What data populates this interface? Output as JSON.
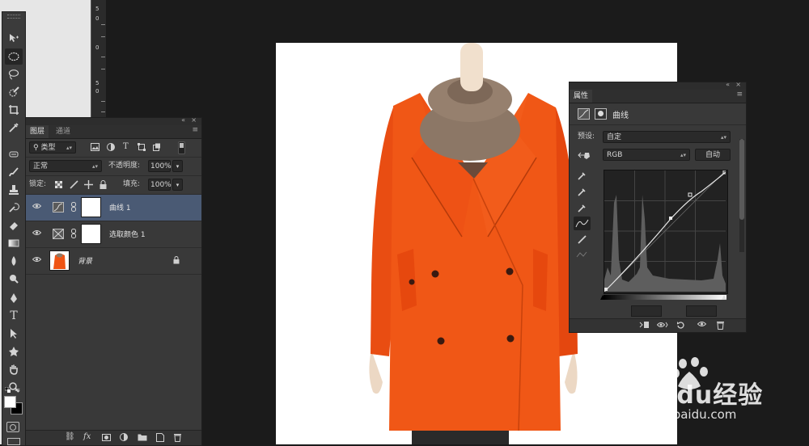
{
  "toolbar": {
    "tools": [
      "move-tool",
      "elliptical-marquee-tool",
      "lasso-tool",
      "quick-selection-tool",
      "crop-tool",
      "eyedropper-tool",
      "spot-healing-tool",
      "brush-tool",
      "clone-stamp-tool",
      "history-brush-tool",
      "eraser-tool",
      "gradient-tool",
      "blur-tool",
      "dodge-tool",
      "pen-tool",
      "type-tool",
      "path-selection-tool",
      "shape-tool",
      "hand-tool",
      "zoom-tool"
    ],
    "type_glyph": "T"
  },
  "ruler": {
    "labels": [
      "5",
      "0",
      "0",
      "5",
      "0"
    ]
  },
  "layers_panel": {
    "tabs": [
      "图层",
      "通道"
    ],
    "filter_kind": "类型",
    "filter_icons": [
      "image-filter-icon",
      "adjustment-filter-icon",
      "T",
      "shape-filter-icon",
      "smart-object-filter-icon"
    ],
    "blend_mode": "正常",
    "opacity_label": "不透明度:",
    "opacity_value": "100%",
    "lock_label": "锁定:",
    "fill_label": "填充:",
    "fill_value": "100%",
    "layers": [
      {
        "name": "曲线 1",
        "type": "curves-adjustment",
        "selected": true
      },
      {
        "name": "选取颜色 1",
        "type": "selective-color-adjustment",
        "selected": false
      },
      {
        "name": "背景",
        "type": "background",
        "selected": false,
        "locked": true
      }
    ],
    "bottom_fx": "fx"
  },
  "properties_panel": {
    "title": "属性",
    "adjustment_name": "曲线",
    "preset_label": "预设:",
    "preset_value": "自定",
    "channel_value": "RGB",
    "auto_button": "自动"
  },
  "watermark": {
    "brand": "Baidu经验",
    "url": "jingyan.baidu.com"
  },
  "colors": {
    "accent_selected_layer": "#4a5a74",
    "coat": "#ef5414",
    "scarf": "#8f7a68"
  }
}
